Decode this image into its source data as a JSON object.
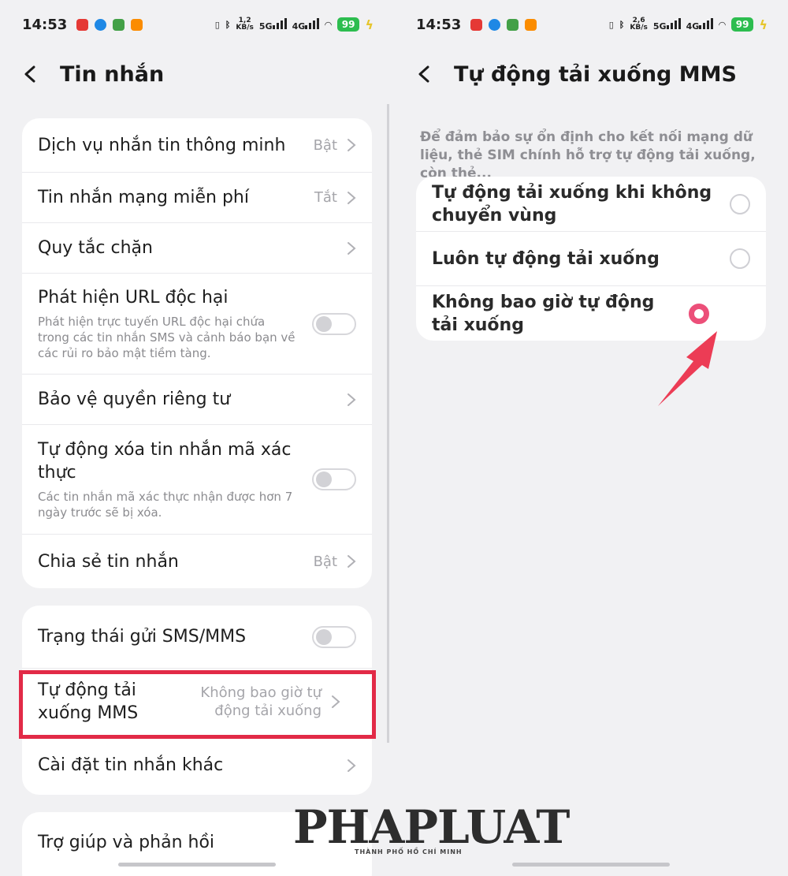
{
  "colors": {
    "accent": "#ec4f79",
    "highlight": "#e22a47",
    "battery": "#2dbd4f"
  },
  "left": {
    "status": {
      "time": "14:53",
      "speed_num": "1,2",
      "speed_unit": "KB/s",
      "net1": "5G",
      "net2": "4G",
      "battery": "99"
    },
    "title": "Tin nhắn",
    "card1": [
      {
        "label": "Dịch vụ nhắn tin thông minh",
        "value": "Bật"
      },
      {
        "label": "Tin nhắn mạng miễn phí",
        "value": "Tắt"
      },
      {
        "label": "Quy tắc chặn"
      },
      {
        "label": "Phát hiện URL độc hại",
        "desc": "Phát hiện trực tuyến URL độc hại chứa trong các tin nhắn SMS và cảnh báo bạn về các rủi ro bảo mật tiềm tàng."
      },
      {
        "label": "Bảo vệ quyền riêng tư"
      },
      {
        "label": "Tự động xóa tin nhắn mã xác thực",
        "desc": "Các tin nhắn mã xác thực nhận được hơn 7 ngày trước sẽ bị xóa."
      },
      {
        "label": "Chia sẻ tin nhắn",
        "value": "Bật"
      }
    ],
    "card2": [
      {
        "label": "Trạng thái gửi SMS/MMS"
      },
      {
        "label": "Tự động tải xuống MMS",
        "value": "Không bao giờ tự động tải xuống"
      },
      {
        "label": "Cài đặt tin nhắn khác"
      }
    ],
    "card3": [
      {
        "label": "Trợ giúp và phản hồi"
      }
    ]
  },
  "right": {
    "status": {
      "time": "14:53",
      "speed_num": "2,6",
      "speed_unit": "KB/s",
      "net1": "5G",
      "net2": "4G",
      "battery": "99"
    },
    "title": "Tự động tải xuống MMS",
    "note": "Để đảm bảo sự ổn định cho kết nối mạng dữ liệu, thẻ SIM chính hỗ trợ tự động tải xuống, còn thẻ...",
    "options": [
      {
        "label": "Tự động tải xuống khi không chuyển vùng",
        "selected": false
      },
      {
        "label": "Luôn tự động tải xuống",
        "selected": false
      },
      {
        "label": "Không bao giờ tự động tải xuống",
        "selected": true
      }
    ]
  },
  "watermark": {
    "brand": "PHAPLUAT",
    "tagline": "THÀNH PHỐ HỒ CHÍ MINH"
  }
}
